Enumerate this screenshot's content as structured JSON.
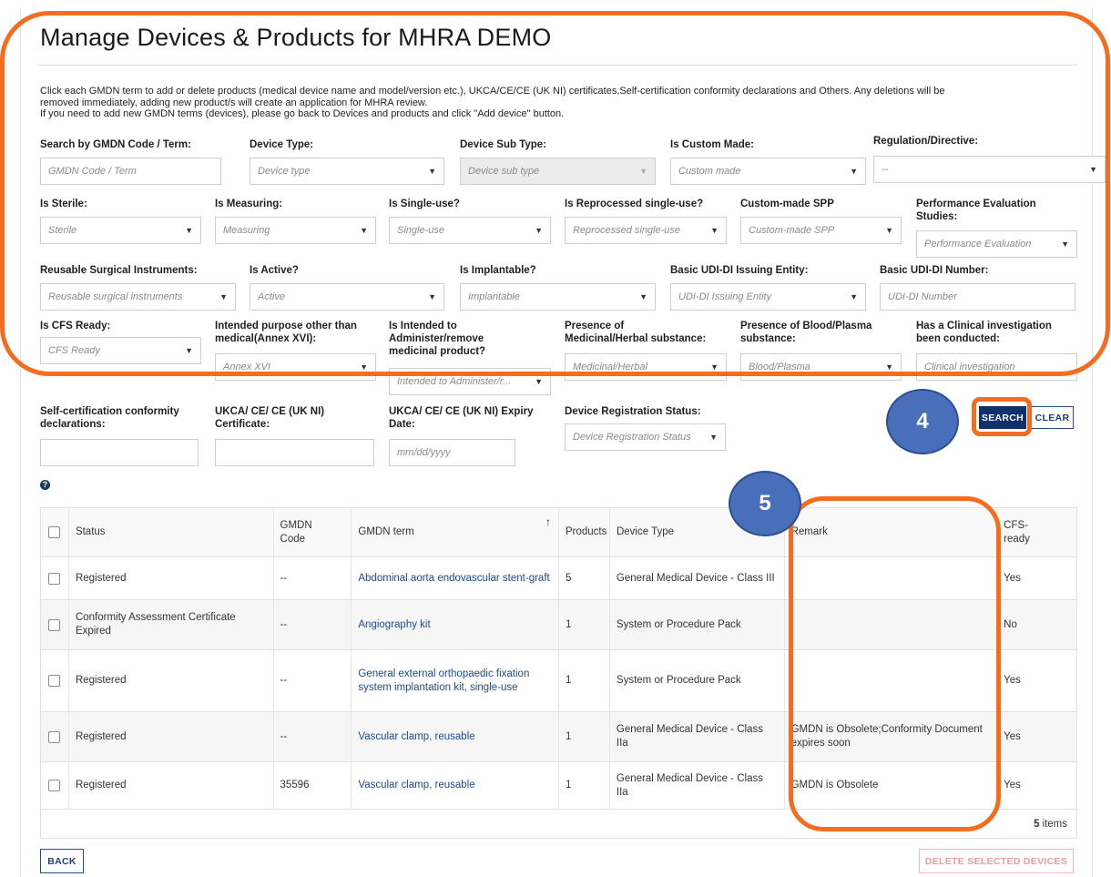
{
  "page": {
    "title": "Manage Devices & Products for MHRA DEMO",
    "intro_line1": "Click each GMDN term to add or delete products (medical device name and model/version etc.), UKCA/CE/CE (UK NI) certificates,Self-certification conformity declarations and Others. Any deletions will be",
    "intro_line2": "removed immediately, adding new product/s will create an application for MHRA review.",
    "intro_line3": "If you need to add new GMDN terms (devices), please go back to Devices and products and click \"Add device\" button."
  },
  "filters": {
    "gmdn": {
      "label": "Search by GMDN Code / Term:",
      "placeholder": "GMDN Code / Term"
    },
    "device_type": {
      "label": "Device Type:",
      "value": "Device type"
    },
    "device_sub_type": {
      "label": "Device Sub Type:",
      "value": "Device sub type"
    },
    "custom_made": {
      "label": "Is Custom Made:",
      "value": "Custom made"
    },
    "regulation": {
      "label": "Regulation/Directive:",
      "value": "--"
    },
    "sterile": {
      "label": "Is Sterile:",
      "value": "Sterile"
    },
    "measuring": {
      "label": "Is Measuring:",
      "value": "Measuring"
    },
    "single_use": {
      "label": "Is Single-use?",
      "value": "Single-use"
    },
    "reprocessed": {
      "label": "Is Reprocessed single-use?",
      "value": "Reprocessed single-use"
    },
    "custom_spp": {
      "label": "Custom-made SPP",
      "value": "Custom-made SPP"
    },
    "performance": {
      "label_1": "Performance Evaluation",
      "label_2": "Studies:",
      "value": "Performance Evaluation"
    },
    "reusable": {
      "label": "Reusable Surgical Instruments:",
      "value": "Reusable surgical instruments"
    },
    "active": {
      "label": "Is Active?",
      "value": "Active"
    },
    "implantable": {
      "label": "Is Implantable?",
      "value": "Implantable"
    },
    "udi_entity": {
      "label": "Basic UDI-DI Issuing Entity:",
      "value": "UDI-DI Issuing Entity"
    },
    "udi_number": {
      "label": "Basic UDI-DI Number:",
      "placeholder": "UDI-DI Number"
    },
    "cfs_ready": {
      "label": "Is CFS Ready:",
      "value": "CFS Ready"
    },
    "intended_purpose": {
      "label_1": "Intended purpose other than",
      "label_2": "medical(Annex XVI):",
      "value": "Annex XVI"
    },
    "administer": {
      "label_1": "Is Intended to",
      "label_2": "Administer/remove",
      "label_3": "medicinal product?",
      "value": "Intended to Administer/r..."
    },
    "medicinal": {
      "label_1": "Presence of",
      "label_2": "Medicinal/Herbal substance:",
      "value": "Medicinal/Herbal"
    },
    "blood": {
      "label_1": "Presence of Blood/Plasma",
      "label_2": "substance:",
      "value": "Blood/Plasma"
    },
    "clinical": {
      "label_1": "Has a Clinical investigation",
      "label_2": "been conducted:",
      "value": "Clinical investigation"
    },
    "self_cert": {
      "label_1": "Self-certification conformity",
      "label_2": "declarations:",
      "value": ""
    },
    "ukca_cert": {
      "label_1": "UKCA/ CE/ CE (UK NI)",
      "label_2": "Certificate:",
      "value": ""
    },
    "expiry": {
      "label_1": "UKCA/ CE/ CE (UK NI) Expiry",
      "label_2": "Date:",
      "placeholder": "mm/dd/yyyy"
    },
    "reg_status": {
      "label": "Device Registration Status:",
      "value": "Device Registration Status"
    }
  },
  "buttons": {
    "search": "SEARCH",
    "clear": "CLEAR",
    "back": "BACK",
    "delete": "DELETE SELECTED DEVICES",
    "help": "?"
  },
  "table": {
    "headers": {
      "status": "Status",
      "gmdn_code_1": "GMDN",
      "gmdn_code_2": "Code",
      "gmdn_term": "GMDN term",
      "products": "Products",
      "device_type": "Device Type",
      "remark": "Remark",
      "cfs_1": "CFS-",
      "cfs_2": "ready",
      "sort_icon": "↑"
    },
    "rows": [
      {
        "status": "Registered",
        "code": "--",
        "term": "Abdominal aorta endovascular stent-graft",
        "products": "5",
        "type": "General Medical Device - Class III",
        "remark": "",
        "cfs": "Yes"
      },
      {
        "status": "Conformity Assessment Certificate Expired",
        "code": "--",
        "term": "Angiography kit",
        "products": "1",
        "type": "System or Procedure Pack",
        "remark": "",
        "cfs": "No"
      },
      {
        "status": "Registered",
        "code": "--",
        "term": "General external orthopaedic fixation system implantation kit, single-use",
        "products": "1",
        "type": "System or Procedure Pack",
        "remark": "",
        "cfs": "Yes"
      },
      {
        "status": "Registered",
        "code": "--",
        "term": "Vascular clamp, reusable",
        "products": "1",
        "type": "General Medical Device - Class IIa",
        "remark": "GMDN is  Obsolete;Conformity Document expires soon",
        "cfs": "Yes"
      },
      {
        "status": "Registered",
        "code": "35596",
        "term": "Vascular clamp, reusable",
        "products": "1",
        "type": "General Medical Device - Class IIa",
        "remark": "GMDN is  Obsolete",
        "cfs": "Yes"
      }
    ],
    "footer_count": "5",
    "footer_label": "items"
  },
  "annotations": {
    "badge_4": "4",
    "badge_5": "5",
    "color": "#f26d1f",
    "badge_color": "#4a6fba"
  }
}
